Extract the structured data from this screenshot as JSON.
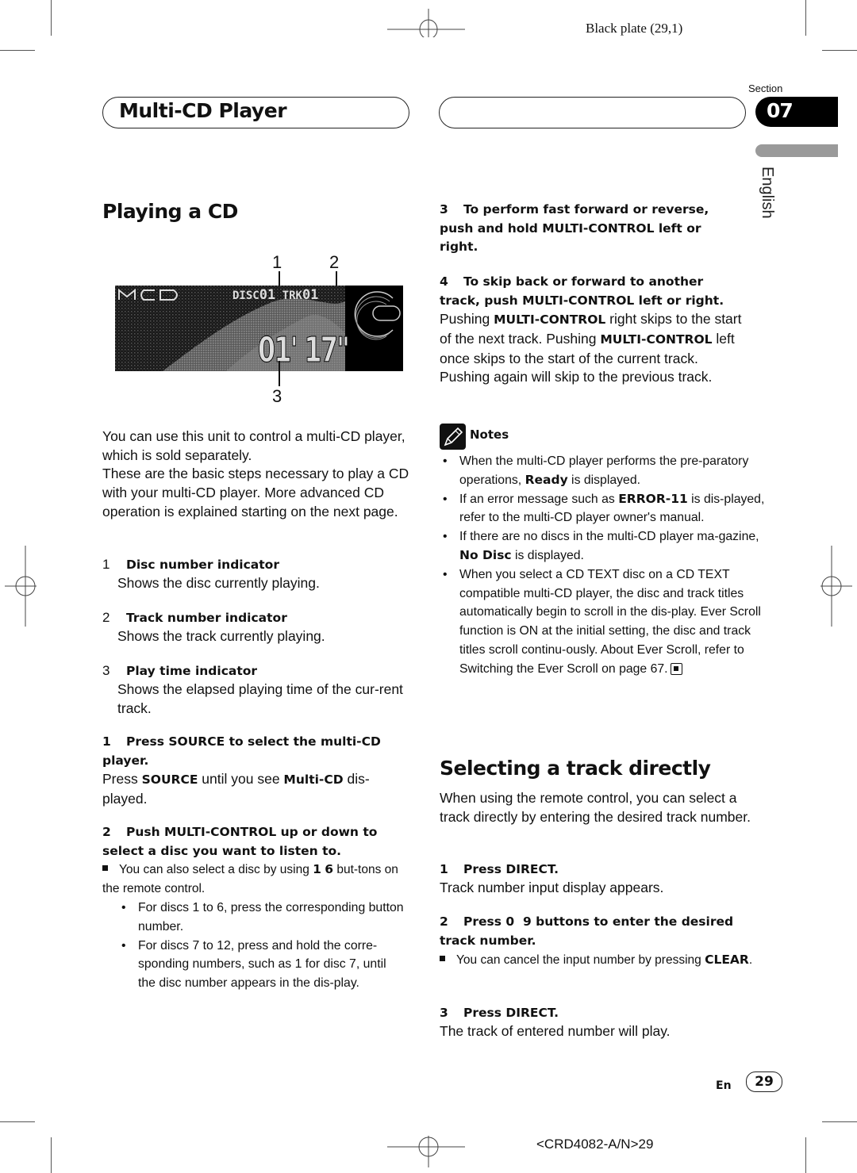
{
  "print_marks": {
    "plate_label": "Black plate (29,1)",
    "footer_code": "<CRD4082-A/N>29"
  },
  "header": {
    "chapter_title": "Multi-CD Player",
    "section_label": "Section",
    "section_number": "07",
    "language_tab": "English"
  },
  "left_column": {
    "heading": "Playing a CD",
    "figure": {
      "display_source": "MCD",
      "disc_label": "DISC",
      "disc_value": "01",
      "track_label": "TRK",
      "track_value": "01",
      "play_time": "01' 17\"",
      "callouts": [
        "1",
        "2",
        "3"
      ]
    },
    "intro_paragraphs": [
      "You can use this unit to control a multi-CD player, which is sold separately.",
      "These are the basic steps necessary to play a CD with your multi-CD player. More advanced CD operation is explained starting on the next page."
    ],
    "indicators": [
      {
        "num": "1",
        "title": "Disc number indicator",
        "desc": "Shows the disc currently playing."
      },
      {
        "num": "2",
        "title": "Track number indicator",
        "desc": "Shows the track currently playing."
      },
      {
        "num": "3",
        "title": "Play time indicator",
        "desc": "Shows the elapsed playing time of the cur-rent track."
      }
    ],
    "steps": [
      {
        "num": "1",
        "title": "Press SOURCE to select the multi-CD player.",
        "body_pre": "Press ",
        "body_bold1": "SOURCE",
        "body_mid": " until you see ",
        "body_bold2": "Multi-CD",
        "body_post": " dis-played."
      },
      {
        "num": "2",
        "title": "Push MULTI-CONTROL up or down to select a disc you want to listen to.",
        "note_pre": "You can also select a disc by using ",
        "note_bold1": "1",
        "note_mid": "  ",
        "note_bold2": "6",
        "note_post": " but-tons on the remote control.",
        "bullets": [
          "For discs 1 to 6, press the corresponding button number.",
          "For discs 7 to 12, press and hold the corre-sponding numbers, such as 1 for disc 7, until the disc number appears in the dis-play."
        ]
      }
    ]
  },
  "right_column": {
    "steps": [
      {
        "num": "3",
        "title": "To perform fast forward or reverse, push and hold MULTI-CONTROL left or right."
      },
      {
        "num": "4",
        "title": "To skip back or forward to another track, push MULTI-CONTROL left or right.",
        "body_1": "Pushing ",
        "body_bold1": "MULTI-CONTROL",
        "body_2": " right skips to the start of the next track. Pushing ",
        "body_bold2": "MULTI-CONTROL",
        "body_3": " left once skips to the start of the current track. Pushing again will skip to the previous track."
      }
    ],
    "notes": {
      "title": "Notes",
      "items": [
        {
          "pre": "When the multi-CD player performs the pre-paratory operations, ",
          "bold": "Ready",
          "post": " is displayed."
        },
        {
          "pre": "If an error message such as ",
          "bold": "ERROR-11",
          "post": " is dis-played, refer to the multi-CD player owner's manual."
        },
        {
          "pre": "If there are no discs in the multi-CD player ma-gazine, ",
          "bold": "No Disc",
          "post": " is displayed."
        },
        {
          "pre": "When you select a CD TEXT disc on a CD TEXT compatible multi-CD player, the disc and track titles automatically begin to scroll in the dis-play. Ever Scroll function is ON at the initial setting, the disc and track titles scroll continu-ously. About Ever Scroll, refer to Switching the Ever Scroll on page 67.",
          "bold": "",
          "post": ""
        }
      ]
    },
    "selecting": {
      "heading": "Selecting a track directly",
      "intro": "When using the remote control, you can select a track directly by entering the desired track number.",
      "steps": [
        {
          "num": "1",
          "title": "Press DIRECT.",
          "body": "Track number input display appears."
        },
        {
          "num": "2",
          "title": "Press 0  9 buttons to enter the desired track number.",
          "note_pre": "You can cancel the input number by pressing ",
          "note_bold": "CLEAR",
          "note_post": "."
        },
        {
          "num": "3",
          "title": "Press DIRECT.",
          "body": "The track of entered number will play."
        }
      ]
    }
  },
  "footer": {
    "lang_code": "En",
    "page_number": "29"
  }
}
